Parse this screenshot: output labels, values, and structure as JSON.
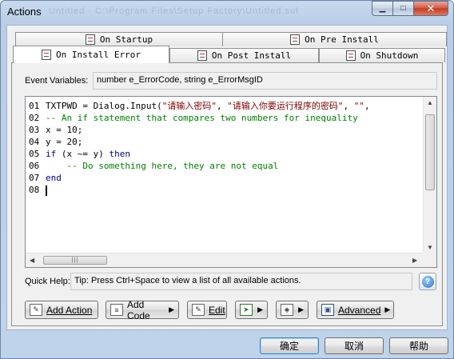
{
  "window": {
    "title": "Actions",
    "title_ghost": "Untitled  ·  C:\\Program Files\\Setup Factory\\Untitled.suf",
    "min_glyph": "▁",
    "max_glyph": "□",
    "close_glyph": "✕"
  },
  "tabs": {
    "startup": "On Startup",
    "pre_install": "On Pre Install",
    "install_error": "On Install Error",
    "post_install": "On Post Install",
    "shutdown": "On Shutdown"
  },
  "event_vars": {
    "label": "Event Variables:",
    "value": "number e_ErrorCode, string e_ErrorMsgID"
  },
  "code": {
    "line_numbers": [
      "01",
      "02",
      "03",
      "04",
      "05",
      "06",
      "07",
      "08"
    ],
    "l1_a": "TXTPWD = Dialog.Input(",
    "l1_s1": "\"请输入密码\"",
    "l1_b": ", ",
    "l1_s2": "\"请输入你要运行程序的密码\"",
    "l1_c": ", ",
    "l1_s3": "\"\"",
    "l1_d": ",",
    "l2": "-- An if statement that compares two numbers for inequality",
    "l3": "x = 10;",
    "l4": "y = 20;",
    "l5_if": "if",
    "l5_mid": " (x ~= y) ",
    "l5_then": "then",
    "l6": "    -- Do something here, they are not equal",
    "l7": "end"
  },
  "scrollbar": {
    "up": "▲",
    "down": "▼",
    "left": "◀",
    "right": "▶",
    "grip": "|||"
  },
  "quick_help": {
    "label": "Quick Help:",
    "text": "Tip: Press Ctrl+Space to view a list of all available actions.",
    "icon_glyph": "?"
  },
  "actions": {
    "add_action": "Add Action",
    "add_code": "Add Code",
    "edit": "Edit",
    "advanced": "Advanced",
    "dropdown_arrow": "▶"
  },
  "dialog": {
    "ok": "确定",
    "cancel": "取消",
    "help": "帮助"
  }
}
